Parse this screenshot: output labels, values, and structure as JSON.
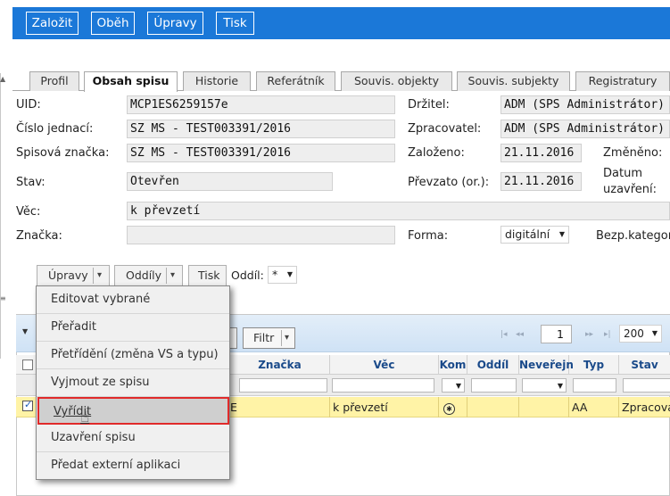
{
  "toolbar": {
    "buttons": [
      "Založit",
      "Oběh",
      "Úpravy",
      "Tisk"
    ]
  },
  "tabs": [
    "Profil",
    "Obsah spisu",
    "Historie",
    "Referátník",
    "Souvis. objekty",
    "Souvis. subjekty",
    "Registratury"
  ],
  "active_tab": "Obsah spisu",
  "form": {
    "uid_label": "UID:",
    "uid_value": "MCP1ES6259157e",
    "cj_label": "Číslo jednací:",
    "cj_value": "SZ MS - TEST003391/2016",
    "sz_label": "Spisová značka:",
    "sz_value": "SZ MS - TEST003391/2016",
    "stav_label": "Stav:",
    "stav_value": "Otevřen",
    "vec_label": "Věc:",
    "vec_value": "k převzetí",
    "znacka_label": "Značka:",
    "znacka_value": "",
    "drzitel_label": "Držitel:",
    "drzitel_value": "ADM (SPS Administrátor)",
    "zpracovatel_label": "Zpracovatel:",
    "zpracovatel_value": "ADM (SPS Administrátor)",
    "zalozeno_label": "Založeno:",
    "zalozeno_value": "21.11.2016",
    "zmeneno_label": "Změněno:",
    "prevzato_label": "Převzato (or.):",
    "prevzato_value": "21.11.2016",
    "datum_uzavreni_label_1": "Datum",
    "datum_uzavreni_label_2": "uzavření:",
    "forma_label": "Forma:",
    "forma_value": "digitální",
    "bezp_label": "Bezp.kategor"
  },
  "actions": {
    "upravy": "Úpravy",
    "oddily": "Oddíly",
    "tisk": "Tisk",
    "oddil_label": "Oddíl:",
    "oddil_value": "*"
  },
  "menu": {
    "items": [
      "Editovat vybrané",
      "Přeřadit",
      "Přetřídění (změna VS a typu)",
      "Vyjmout ze spisu",
      "Vyřídit",
      "Uzavření spisu",
      "Předat externí aplikaci"
    ],
    "highlighted_index": 4
  },
  "grid": {
    "filter_button": "Filtr",
    "page_number": "1",
    "page_size": "200",
    "columns": [
      "Značka",
      "Věc",
      "Kom",
      "Oddíl",
      "Neveřejn",
      "Typ",
      "Stav"
    ],
    "row": {
      "znacka_tail": "E",
      "vec": "k převzetí",
      "typ": "AA",
      "stav": "Zpracova"
    }
  },
  "colors": {
    "toolbar_bg": "#1b78d8",
    "highlight_border": "#e02a2a",
    "row_selected": "#fff3a6",
    "header_text": "#1a4a8a"
  }
}
